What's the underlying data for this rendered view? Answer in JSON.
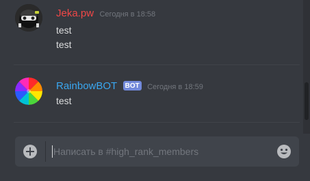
{
  "messages": [
    {
      "author": "Jeka.pw",
      "author_color": "#f04747",
      "timestamp": "Сегодня в 18:58",
      "lines": [
        "test",
        "test"
      ],
      "avatar_icon": "helmet-avatar"
    },
    {
      "author": "RainbowBOT",
      "author_color": "#3aa7f0",
      "bot_tag": "BOT",
      "timestamp": "Сегодня в 18:59",
      "lines": [
        "test"
      ],
      "avatar_icon": "rainbow-wheel-avatar"
    }
  ],
  "composer": {
    "placeholder": "Написать в #high_rank_members",
    "value": "",
    "add_icon": "plus-circle-icon",
    "emoji_icon": "smiley-icon"
  },
  "colors": {
    "background": "#36393f",
    "composer_bg": "#40444b",
    "bot_tag_bg": "#7289da"
  }
}
